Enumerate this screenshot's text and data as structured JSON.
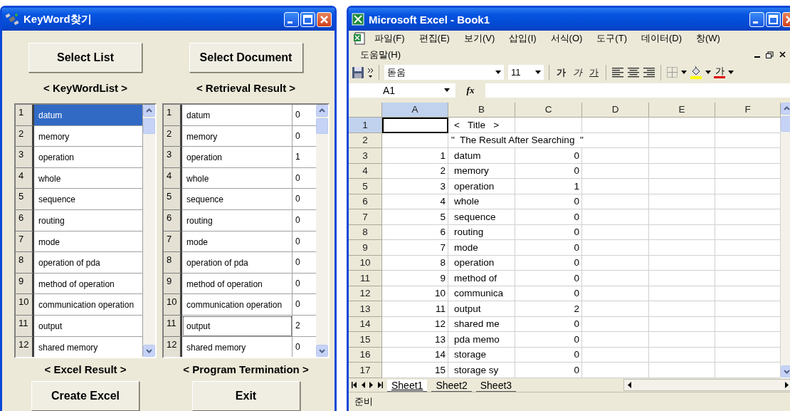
{
  "keyword_window": {
    "title": "KeyWord찾기",
    "top_buttons": [
      "Select List",
      "Select Document"
    ],
    "top_captions": [
      "< KeyWordList >",
      "< Retrieval Result >"
    ],
    "keyword_list": [
      {
        "number": "1",
        "keyword": "datum",
        "selected": true
      },
      {
        "number": "2",
        "keyword": "memory",
        "selected": false
      },
      {
        "number": "3",
        "keyword": "operation",
        "selected": false
      },
      {
        "number": "4",
        "keyword": "whole",
        "selected": false
      },
      {
        "number": "5",
        "keyword": "sequence",
        "selected": false
      },
      {
        "number": "6",
        "keyword": "routing",
        "selected": false
      },
      {
        "number": "7",
        "keyword": "mode",
        "selected": false
      },
      {
        "number": "8",
        "keyword": "operation of pda",
        "selected": false
      },
      {
        "number": "9",
        "keyword": "method of operation",
        "selected": false
      },
      {
        "number": "10",
        "keyword": "communication operation",
        "selected": false
      },
      {
        "number": "11",
        "keyword": "output",
        "selected": false
      },
      {
        "number": "12",
        "keyword": "shared memory",
        "selected": false
      }
    ],
    "result_list": [
      {
        "number": "1",
        "keyword": "datum",
        "count": "0",
        "focused": false
      },
      {
        "number": "2",
        "keyword": "memory",
        "count": "0",
        "focused": false
      },
      {
        "number": "3",
        "keyword": "operation",
        "count": "1",
        "focused": false
      },
      {
        "number": "4",
        "keyword": "whole",
        "count": "0",
        "focused": false
      },
      {
        "number": "5",
        "keyword": "sequence",
        "count": "0",
        "focused": false
      },
      {
        "number": "6",
        "keyword": "routing",
        "count": "0",
        "focused": false
      },
      {
        "number": "7",
        "keyword": "mode",
        "count": "0",
        "focused": false
      },
      {
        "number": "8",
        "keyword": "operation of pda",
        "count": "0",
        "focused": false
      },
      {
        "number": "9",
        "keyword": "method of operation",
        "count": "0",
        "focused": false
      },
      {
        "number": "10",
        "keyword": "communication operation",
        "count": "0",
        "focused": false
      },
      {
        "number": "11",
        "keyword": "output",
        "count": "2",
        "focused": true
      },
      {
        "number": "12",
        "keyword": "shared memory",
        "count": "0",
        "focused": false
      }
    ],
    "bottom_captions": [
      "< Excel Result >",
      "< Program Termination >"
    ],
    "bottom_buttons": [
      "Create Excel",
      "Exit"
    ]
  },
  "excel_window": {
    "title": "Microsoft Excel - Book1",
    "menu": [
      "파일(F)",
      "편집(E)",
      "보기(V)",
      "삽입(I)",
      "서식(O)",
      "도구(T)",
      "데이터(D)",
      "창(W)"
    ],
    "menu_second_row": [
      "도움말(H)"
    ],
    "font_name": "돋움",
    "font_size": "11",
    "style_buttons": [
      {
        "kind": "bold",
        "glyph": "가"
      },
      {
        "kind": "italic",
        "glyph": "가"
      },
      {
        "kind": "underline",
        "glyph": "가"
      }
    ],
    "font_color_glyph": "가",
    "name_box": "A1",
    "function_label": "fx",
    "columns": [
      {
        "label": "A",
        "selected": true
      },
      {
        "label": "B",
        "selected": false
      },
      {
        "label": "C",
        "selected": false
      },
      {
        "label": "D",
        "selected": false
      },
      {
        "label": "E",
        "selected": false
      },
      {
        "label": "F",
        "selected": false
      }
    ],
    "rows": [
      {
        "header": "1",
        "kind": "title",
        "selected": true,
        "text": "<   Title   >"
      },
      {
        "header": "2",
        "kind": "banner",
        "selected": false,
        "text": "\"  The Result After Searching  \""
      },
      {
        "header": "3",
        "kind": "data",
        "selected": false,
        "a": "1",
        "b": "datum",
        "c": "0"
      },
      {
        "header": "4",
        "kind": "data",
        "selected": false,
        "a": "2",
        "b": "memory",
        "c": "0"
      },
      {
        "header": "5",
        "kind": "data",
        "selected": false,
        "a": "3",
        "b": "operation",
        "c": "1"
      },
      {
        "header": "6",
        "kind": "data",
        "selected": false,
        "a": "4",
        "b": "whole",
        "c": "0"
      },
      {
        "header": "7",
        "kind": "data",
        "selected": false,
        "a": "5",
        "b": "sequence",
        "c": "0"
      },
      {
        "header": "8",
        "kind": "data",
        "selected": false,
        "a": "6",
        "b": "routing",
        "c": "0"
      },
      {
        "header": "9",
        "kind": "data",
        "selected": false,
        "a": "7",
        "b": "mode",
        "c": "0"
      },
      {
        "header": "10",
        "kind": "data",
        "selected": false,
        "a": "8",
        "b": "operation",
        "c": "0"
      },
      {
        "header": "11",
        "kind": "data",
        "selected": false,
        "a": "9",
        "b": "method of",
        "c": "0"
      },
      {
        "header": "12",
        "kind": "data",
        "selected": false,
        "a": "10",
        "b": "communica",
        "c": "0"
      },
      {
        "header": "13",
        "kind": "data",
        "selected": false,
        "a": "11",
        "b": "output",
        "c": "2"
      },
      {
        "header": "14",
        "kind": "data",
        "selected": false,
        "a": "12",
        "b": "shared me",
        "c": "0"
      },
      {
        "header": "15",
        "kind": "data",
        "selected": false,
        "a": "13",
        "b": "pda memo",
        "c": "0"
      },
      {
        "header": "16",
        "kind": "data",
        "selected": false,
        "a": "14",
        "b": "storage",
        "c": "0"
      },
      {
        "header": "17",
        "kind": "data",
        "selected": false,
        "a": "15",
        "b": "storage sy",
        "c": "0"
      }
    ],
    "sheet_tabs": [
      {
        "label": "Sheet1",
        "selected": true
      },
      {
        "label": "Sheet2",
        "selected": false
      },
      {
        "label": "Sheet3",
        "selected": false
      }
    ],
    "status": "준비"
  }
}
